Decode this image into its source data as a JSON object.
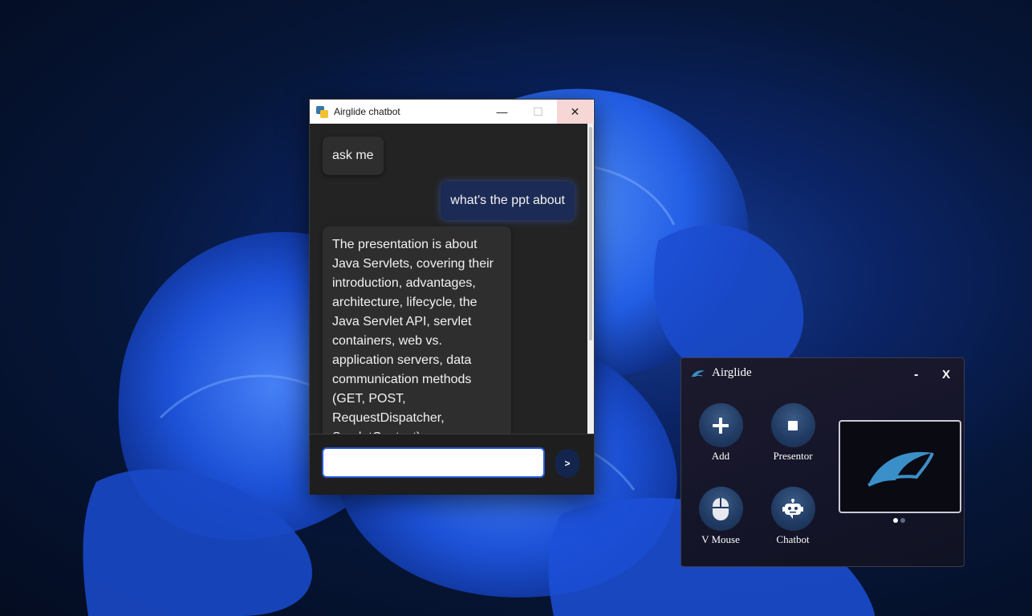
{
  "chatbot": {
    "window_title": "Airglide chatbot",
    "minimize_glyph": "—",
    "maximize_glyph": "☐",
    "close_glyph": "✕",
    "messages": [
      {
        "role": "bot",
        "text": "ask me"
      },
      {
        "role": "user",
        "text": "what's the ppt about"
      },
      {
        "role": "bot",
        "text": "The presentation is about Java Servlets, covering their introduction, advantages, architecture, lifecycle, the Java Servlet API, servlet containers, web vs. application servers, data communication methods (GET, POST, RequestDispatcher, ServletContext), HttpServlet..."
      }
    ],
    "input": {
      "value": "",
      "placeholder": ""
    },
    "send_label": ">"
  },
  "airglide": {
    "title": "Airglide",
    "minimize_label": "-",
    "close_label": "X",
    "tools": [
      {
        "label": "Add",
        "icon": "plus-icon"
      },
      {
        "label": "Presentor",
        "icon": "stop-square-icon"
      },
      {
        "label": "V Mouse",
        "icon": "mouse-icon"
      },
      {
        "label": "Chatbot",
        "icon": "robot-icon"
      }
    ],
    "preview": {
      "icon": "airglide-logo-icon"
    },
    "carousel": {
      "count": 2,
      "active_index": 0
    }
  },
  "colors": {
    "accent": "#2a5bd7",
    "user_bubble": "#1c2b55",
    "bot_bubble": "#2e2e2e",
    "brand_logo": "#3b8fc9"
  }
}
